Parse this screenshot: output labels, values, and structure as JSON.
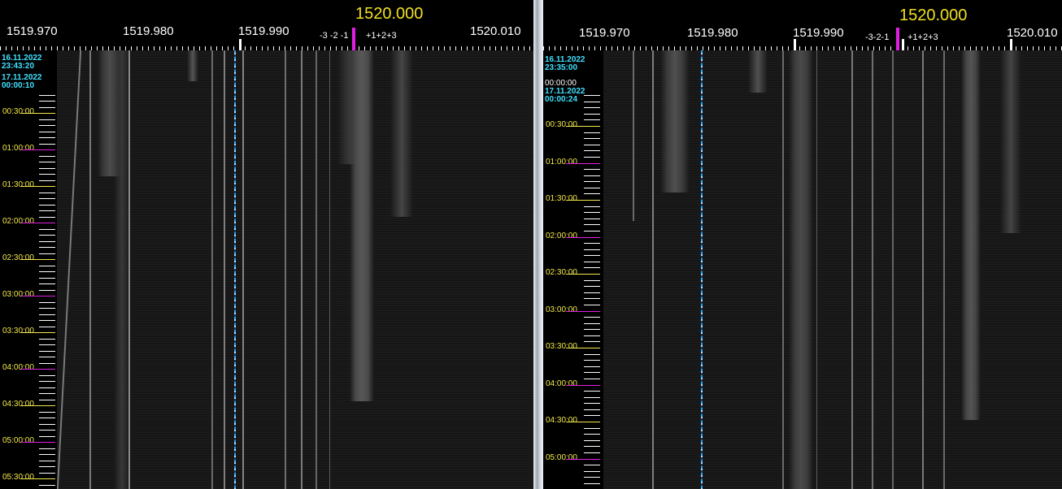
{
  "left": {
    "center_freq": "1520.000",
    "freq_labels": [
      "1519.970",
      "1519.980",
      "1519.990",
      "1520.010"
    ],
    "offsets_minus": "-3 -2 -1",
    "offsets_plus": "+1+2+3",
    "dates": [
      {
        "date": "16.11.2022",
        "time": "23:43:20"
      },
      {
        "date": "17.11.2022",
        "time": "00:00:10"
      }
    ],
    "times": [
      "00:30:00",
      "01:00:00",
      "01:30:00",
      "02:00:00",
      "02:30:00",
      "03:00:00",
      "03:30:00",
      "04:00:00",
      "04:30:00",
      "05:00:00",
      "05:30:00"
    ]
  },
  "right": {
    "center_freq": "1520.000",
    "freq_labels": [
      "1519.970",
      "1519.980",
      "1519.990",
      "1520.010"
    ],
    "offsets_minus": "-3-2-1",
    "offsets_plus": "+1+2+3",
    "dates": [
      {
        "date": "16.11.2022",
        "time": "23:35:00"
      },
      {
        "date": "17.11.2022",
        "time": "00:00:24"
      }
    ],
    "overlap_time": "00:00:00",
    "times": [
      "00:30:00",
      "01:00:00",
      "01:30:00",
      "02:00:00",
      "02:30:00",
      "03:00:00",
      "03:30:00",
      "04:00:00",
      "04:30:00",
      "05:00:00"
    ]
  },
  "colors": {
    "time_label": "#f4e84a",
    "date_label": "#40e0ff",
    "center_freq": "#f0e020",
    "marker": "#e020e0",
    "background": "#000000"
  }
}
